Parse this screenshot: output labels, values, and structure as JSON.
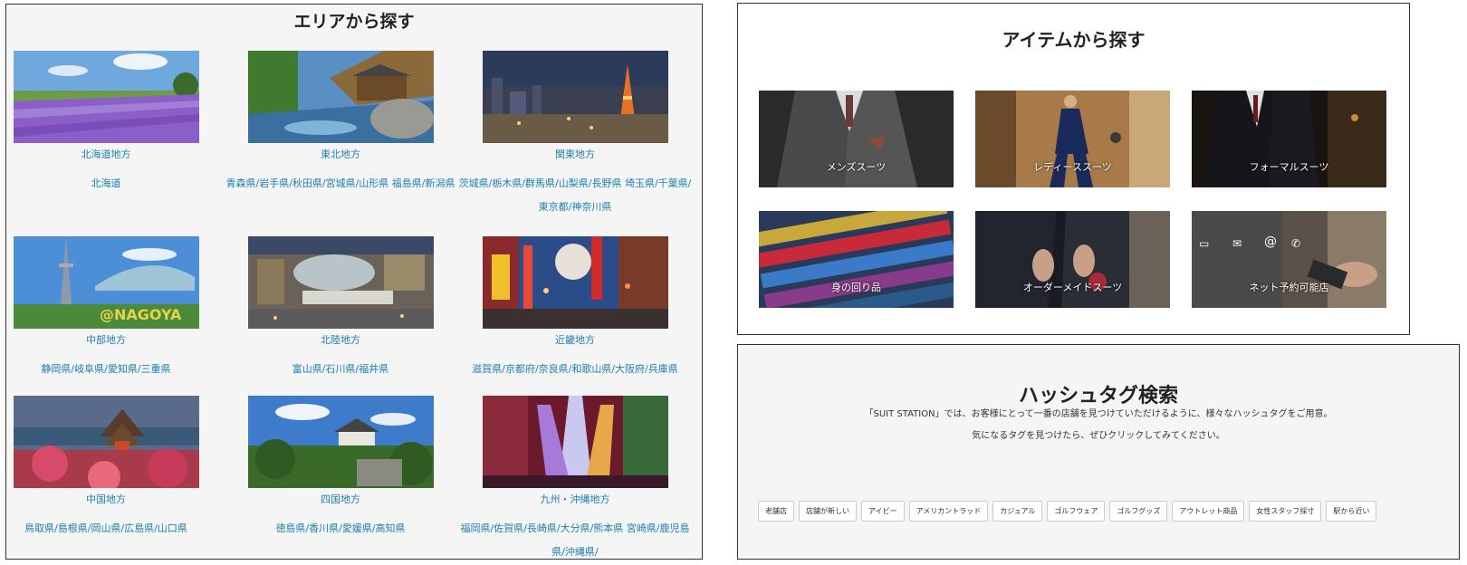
{
  "area": {
    "title": "エリアから探す",
    "regions": [
      {
        "name": "北海道地方",
        "prefs": "北海道",
        "image": "lavender-field-photo"
      },
      {
        "name": "東北地方",
        "prefs": "青森県/岩手県/秋田県/宮城県/山形県 福島県/新潟県",
        "image": "onsen-river-photo"
      },
      {
        "name": "関東地方",
        "prefs": "茨城県/栃木県/群馬県/山梨県/長野県 埼玉県/千葉県/東京都/神奈川県",
        "image": "tokyo-tower-night-photo"
      },
      {
        "name": "中部地方",
        "prefs": "静岡県/岐阜県/愛知県/三重県",
        "image": "nagoya-tv-tower-photo"
      },
      {
        "name": "北陸地方",
        "prefs": "富山県/石川県/福井県",
        "image": "kanazawa-station-photo"
      },
      {
        "name": "近畿地方",
        "prefs": "滋賀県/京都府/奈良県/和歌山県/大阪府/兵庫県",
        "image": "dotonbori-street-photo"
      },
      {
        "name": "中国地方",
        "prefs": "鳥取県/島根県/岡山県/広島県/山口県",
        "image": "miyajima-pagoda-photo"
      },
      {
        "name": "四国地方",
        "prefs": "徳島県/香川県/愛媛県/高知県",
        "image": "castle-forest-photo"
      },
      {
        "name": "九州・沖縄地方",
        "prefs": "福岡県/佐賀県/長崎県/大分県/熊本県 宮崎県/鹿児島県/沖縄県/",
        "image": "canal-city-fountain-photo"
      }
    ]
  },
  "items": {
    "title": "アイテムから探す",
    "tiles": [
      {
        "label": "メンズスーツ"
      },
      {
        "label": "レディーススーツ"
      },
      {
        "label": "フォーマルスーツ"
      },
      {
        "label": "身の回り品"
      },
      {
        "label": "オーダーメイドスーツ"
      },
      {
        "label": "ネット予約可能店"
      }
    ]
  },
  "hashtags": {
    "title": "ハッシュタグ検索",
    "desc1": "「SUIT STATION」では、お客様にとって一番の店舗を見つけていただけるように、様々なハッシュタグをご用意。",
    "desc2": "気になるタグを見つけたら、ぜひクリックしてみてください。",
    "tags": [
      "老舗店",
      "店舗が新しい",
      "アイビー",
      "アメリカントラッド",
      "カジュアル",
      "ゴルフウェア",
      "ゴルフグッズ",
      "アウトレット商品",
      "女性スタッフ採寸",
      "駅から近い"
    ]
  }
}
